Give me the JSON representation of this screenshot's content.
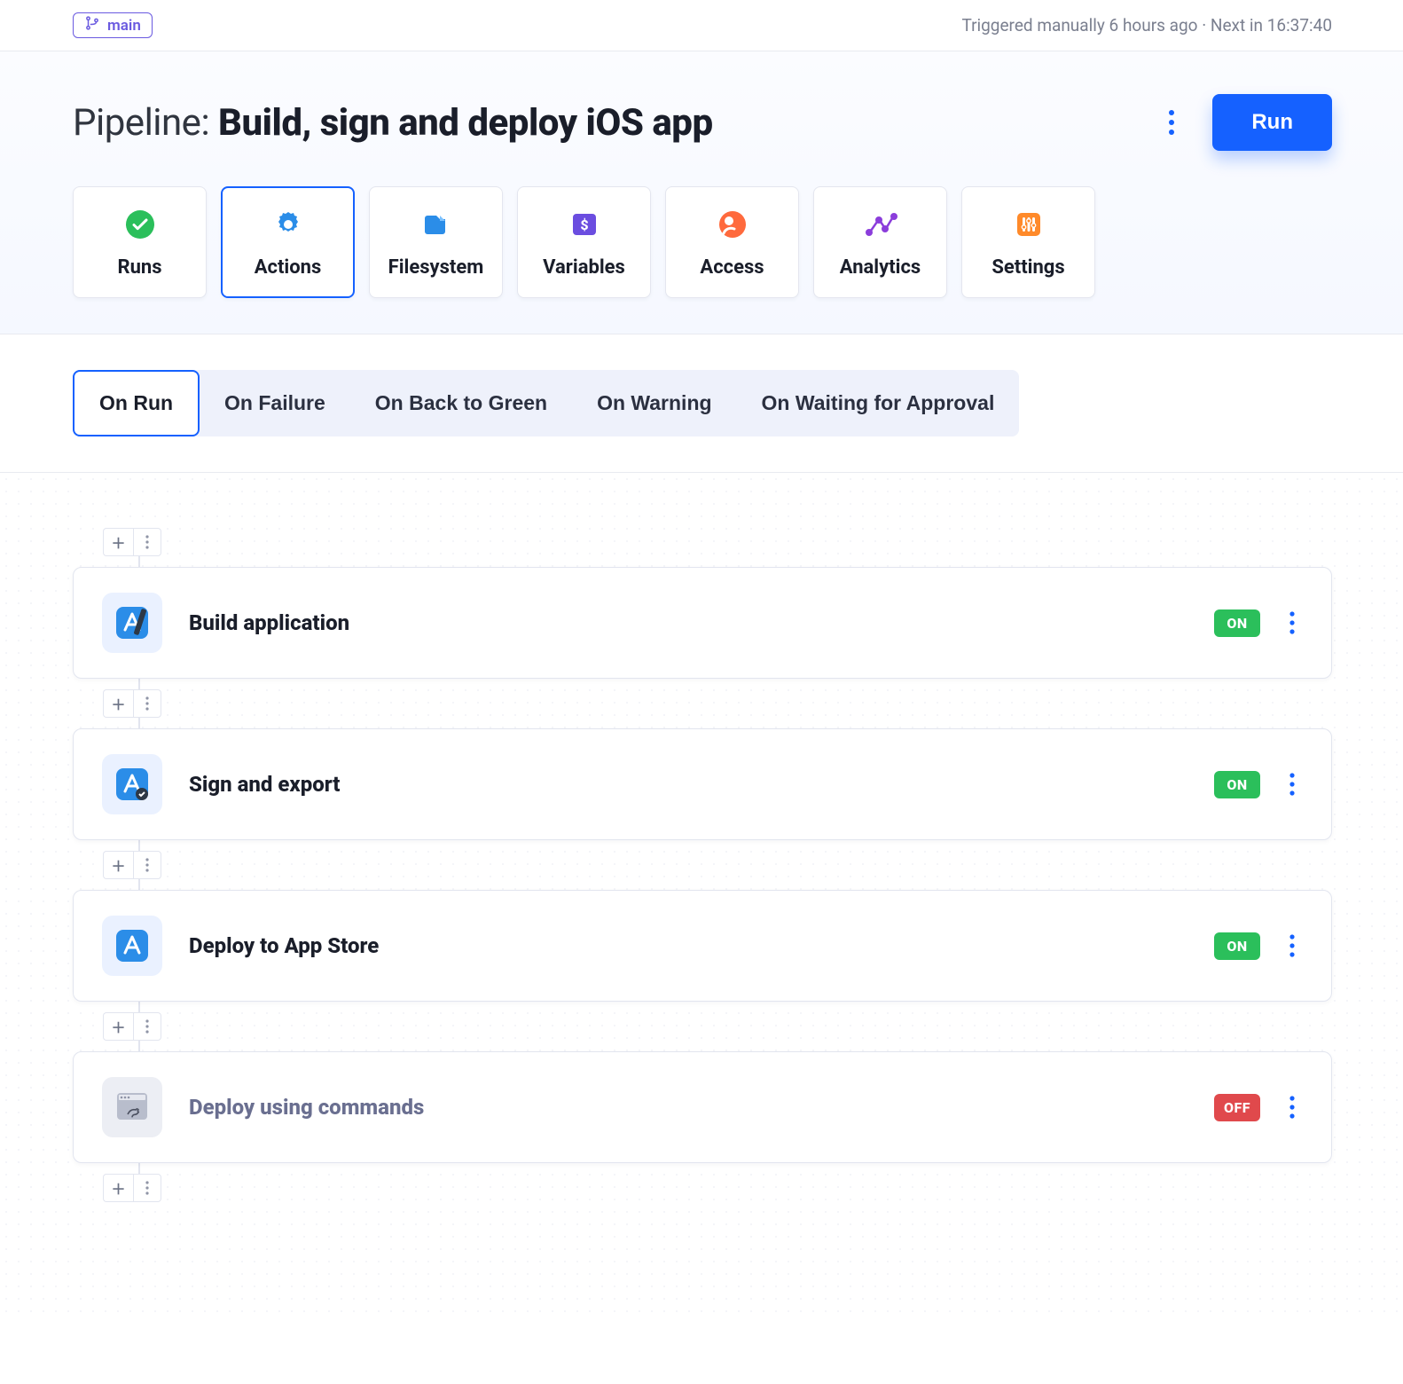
{
  "topbar": {
    "branch": "main",
    "trigger_text": "Triggered manually 6 hours ago · Next in 16:37:40"
  },
  "header": {
    "title_prefix": "Pipeline: ",
    "title_bold": "Build, sign and deploy iOS app",
    "run_label": "Run"
  },
  "nav": {
    "tabs": [
      {
        "label": "Runs"
      },
      {
        "label": "Actions"
      },
      {
        "label": "Filesystem"
      },
      {
        "label": "Variables"
      },
      {
        "label": "Access"
      },
      {
        "label": "Analytics"
      },
      {
        "label": "Settings"
      }
    ],
    "active_index": 1
  },
  "subtabs": {
    "items": [
      "On Run",
      "On Failure",
      "On Back to Green",
      "On Warning",
      "On Waiting for Approval"
    ],
    "active_index": 0
  },
  "actions": [
    {
      "title": "Build application",
      "state": "ON",
      "muted": false,
      "icon": "xcode"
    },
    {
      "title": "Sign and export",
      "state": "ON",
      "muted": false,
      "icon": "sign"
    },
    {
      "title": "Deploy to App Store",
      "state": "ON",
      "muted": false,
      "icon": "appstore"
    },
    {
      "title": "Deploy using commands",
      "state": "OFF",
      "muted": true,
      "icon": "terminal"
    }
  ],
  "labels": {
    "on": "ON",
    "off": "OFF"
  }
}
